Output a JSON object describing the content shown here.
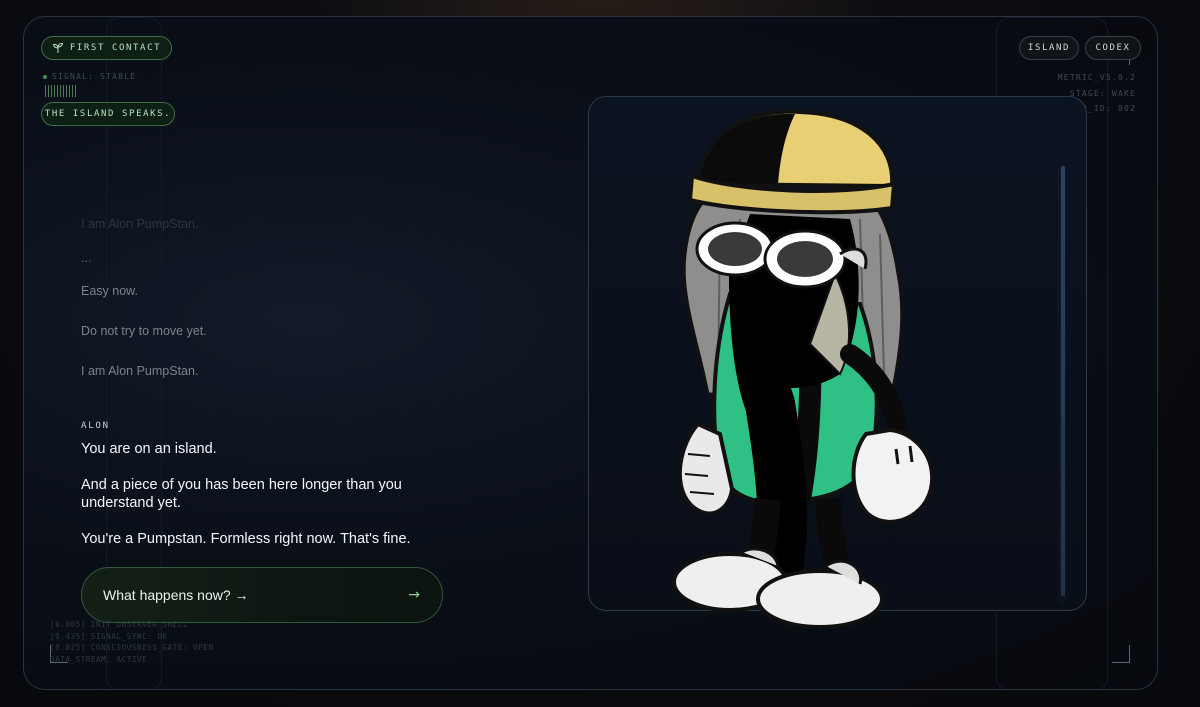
{
  "header": {
    "first_contact": "FIRST CONTACT",
    "signal": "SIGNAL: STABLE",
    "island_speaks": "THE ISLAND SPEAKS.",
    "nav": [
      "ISLAND",
      "CODEX"
    ]
  },
  "meta": {
    "version": "METRIC_V5.0.2",
    "stage": "STAGE: WAKE",
    "seq": "SEQ_ID: 002"
  },
  "dialogue": {
    "history": [
      "I am Alon PumpStan.",
      "...",
      "Easy now.",
      "Do not try to move yet.",
      "I am Alon PumpStan."
    ],
    "speaker": "ALON",
    "messages": [
      "You are on an island.",
      "And a piece of you has been here longer than you understand yet.",
      "You're a Pumpstan. Formless right now. That's fine."
    ]
  },
  "cta": {
    "label": "What happens now? →",
    "arrow": "→"
  },
  "log": [
    "[0.005] INIT OBSERVER_SHELL",
    "[0.435] SIGNAL_SYNC: OK",
    "[0.025] CONSCIOUSNESS_GATE: OPEN",
    "DATA_STREAM: ACTIVE"
  ],
  "icons": {
    "first_contact": "sprout-icon",
    "cta": "arrow-right-icon"
  },
  "colors": {
    "accent_green": "#8fd19c",
    "hat_yellow": "#e8cf73",
    "shirt_green": "#3cc58a"
  }
}
